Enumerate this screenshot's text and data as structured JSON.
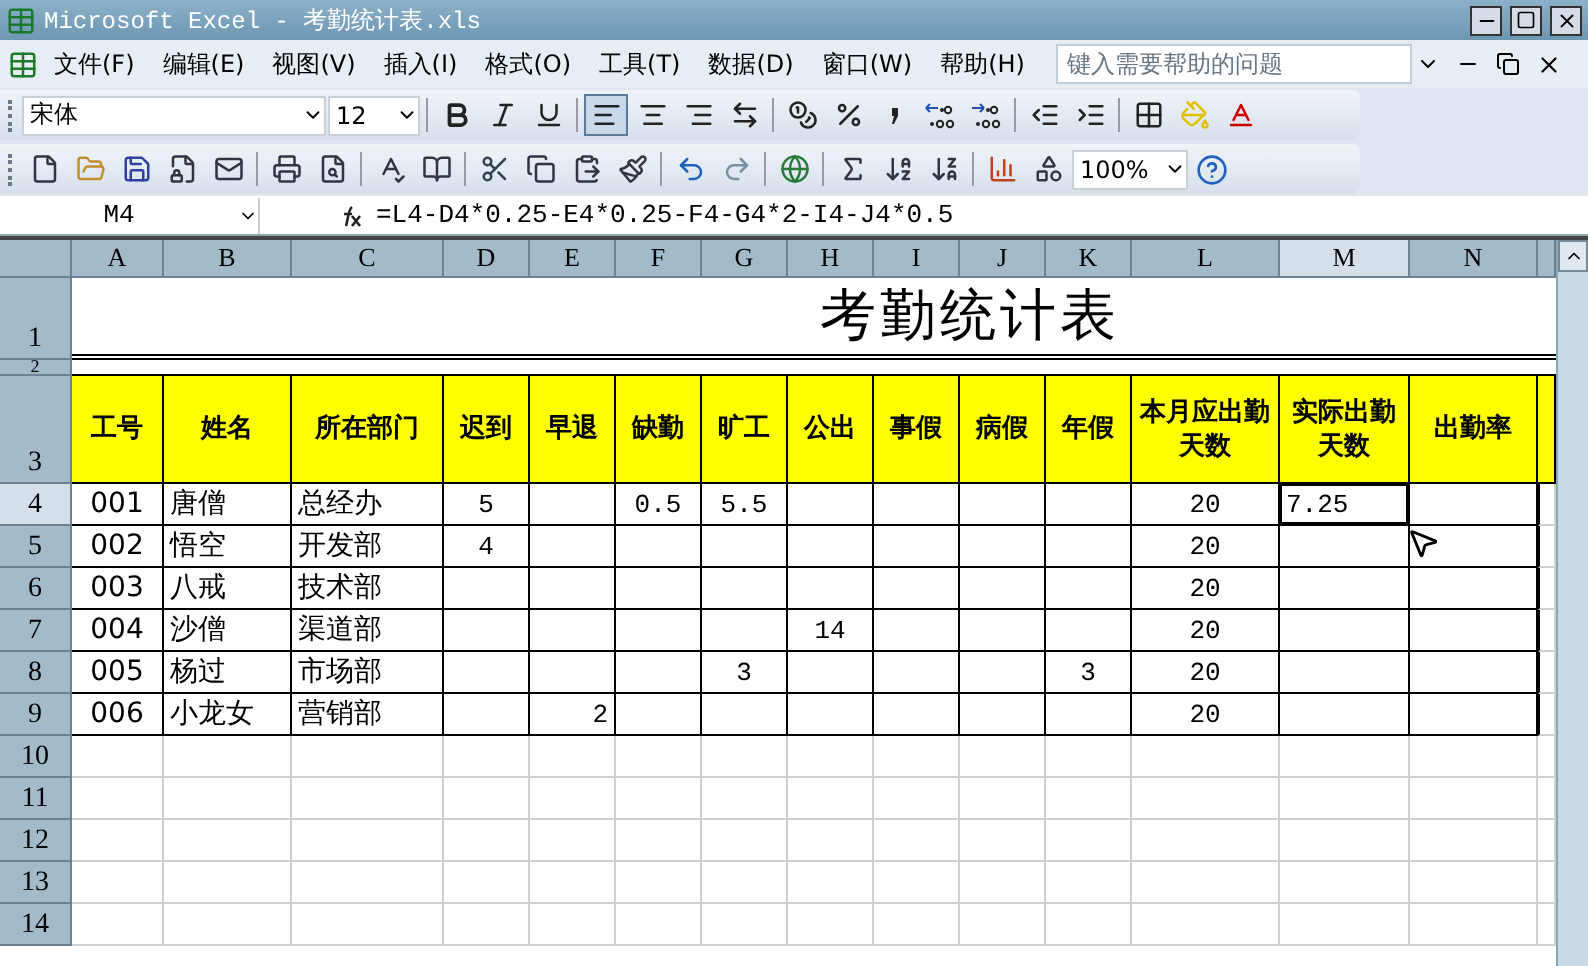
{
  "window": {
    "title": "Microsoft Excel - 考勤统计表.xls"
  },
  "menu": [
    "文件(F)",
    "编辑(E)",
    "视图(V)",
    "插入(I)",
    "格式(O)",
    "工具(T)",
    "数据(D)",
    "窗口(W)",
    "帮助(H)"
  ],
  "help_search": {
    "placeholder": "键入需要帮助的问题"
  },
  "format_toolbar": {
    "font": "宋体",
    "size": "12",
    "buttons": [
      {
        "kind": "bold",
        "selected": false
      },
      {
        "kind": "italic",
        "selected": false
      },
      {
        "kind": "underline",
        "selected": false
      },
      {
        "kind": "align-left",
        "selected": true
      },
      {
        "kind": "align-center",
        "selected": false
      },
      {
        "kind": "align-right",
        "selected": false
      },
      {
        "kind": "merge",
        "selected": false
      },
      {
        "kind": "currency",
        "selected": false
      },
      {
        "kind": "percent",
        "selected": false
      },
      {
        "kind": "comma",
        "selected": false
      },
      {
        "kind": "increase-decimal",
        "selected": false
      },
      {
        "kind": "decrease-decimal",
        "selected": false
      },
      {
        "kind": "outdent",
        "selected": false
      },
      {
        "kind": "indent",
        "selected": false
      },
      {
        "kind": "borders",
        "selected": false
      },
      {
        "kind": "fill-color",
        "selected": false
      },
      {
        "kind": "font-color",
        "selected": false
      }
    ]
  },
  "standard_toolbar": {
    "zoom": "100%",
    "buttons": [
      {
        "kind": "new"
      },
      {
        "kind": "open"
      },
      {
        "kind": "save"
      },
      {
        "kind": "permission"
      },
      {
        "kind": "email"
      },
      {
        "kind": "print"
      },
      {
        "kind": "preview"
      },
      {
        "kind": "spelling"
      },
      {
        "kind": "research"
      },
      {
        "kind": "cut"
      },
      {
        "kind": "copy"
      },
      {
        "kind": "paste"
      },
      {
        "kind": "format-painter"
      },
      {
        "kind": "undo"
      },
      {
        "kind": "redo"
      },
      {
        "kind": "hyperlink"
      },
      {
        "kind": "sum"
      },
      {
        "kind": "sort-ascending"
      },
      {
        "kind": "sort-descending"
      },
      {
        "kind": "chart"
      },
      {
        "kind": "drawing"
      }
    ]
  },
  "formula_bar": {
    "name_box": "M4",
    "formula": "=L4-D4*0.25-E4*0.25-F4-G4*2-I4-J4*0.5"
  },
  "sheet": {
    "columns": [
      {
        "label": "A",
        "selected": false
      },
      {
        "label": "B",
        "selected": false
      },
      {
        "label": "C",
        "selected": false
      },
      {
        "label": "D",
        "selected": false
      },
      {
        "label": "E",
        "selected": false
      },
      {
        "label": "F",
        "selected": false
      },
      {
        "label": "G",
        "selected": false
      },
      {
        "label": "H",
        "selected": false
      },
      {
        "label": "I",
        "selected": false
      },
      {
        "label": "J",
        "selected": false
      },
      {
        "label": "K",
        "selected": false
      },
      {
        "label": "L",
        "selected": false
      },
      {
        "label": "M",
        "selected": true
      },
      {
        "label": "N",
        "selected": false
      }
    ],
    "title_row": {
      "number": "1",
      "text": "考勤统计表"
    },
    "spacer_row": {
      "number": "2"
    },
    "header_row": {
      "number": "3",
      "cells": [
        "工号",
        "姓名",
        "所在部门",
        "迟到",
        "早退",
        "缺勤",
        "旷工",
        "公出",
        "事假",
        "病假",
        "年假",
        "本月应出勤天数",
        "实际出勤天数",
        "出勤率"
      ]
    },
    "rows": [
      {
        "number": "4",
        "selected": true,
        "cells": [
          "001",
          "唐僧",
          "总经办",
          "5",
          "",
          "0.5",
          "5.5",
          "",
          "",
          "",
          "",
          "20",
          "7.25",
          ""
        ]
      },
      {
        "number": "5",
        "selected": false,
        "cells": [
          "002",
          "悟空",
          "开发部",
          "4",
          "",
          "",
          "",
          "",
          "",
          "",
          "",
          "20",
          "",
          ""
        ]
      },
      {
        "number": "6",
        "selected": false,
        "cells": [
          "003",
          "八戒",
          "技术部",
          "",
          "",
          "",
          "",
          "",
          "",
          "",
          "",
          "20",
          "",
          ""
        ]
      },
      {
        "number": "7",
        "selected": false,
        "cells": [
          "004",
          "沙僧",
          "渠道部",
          "",
          "",
          "",
          "",
          "14",
          "",
          "",
          "",
          "20",
          "",
          ""
        ]
      },
      {
        "number": "8",
        "selected": false,
        "cells": [
          "005",
          "杨过",
          "市场部",
          "",
          "",
          "",
          "3",
          "",
          "",
          "",
          "3",
          "20",
          "",
          ""
        ]
      },
      {
        "number": "9",
        "selected": false,
        "cells": [
          "006",
          "小龙女",
          "营销部",
          "",
          "2",
          "",
          "",
          "",
          "",
          "",
          "",
          "20",
          "",
          ""
        ]
      },
      {
        "number": "10",
        "selected": false
      },
      {
        "number": "11",
        "selected": false
      },
      {
        "number": "12",
        "selected": false
      },
      {
        "number": "13",
        "selected": false
      },
      {
        "number": "14",
        "selected": false
      }
    ]
  }
}
